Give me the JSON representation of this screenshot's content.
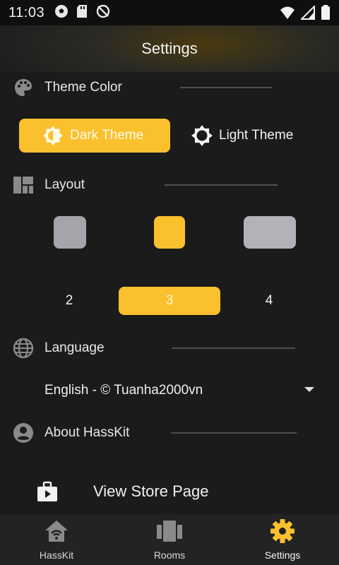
{
  "status_bar": {
    "time": "11:03"
  },
  "app_bar": {
    "title": "Settings"
  },
  "sections": {
    "theme": {
      "label": "Theme Color"
    },
    "layout": {
      "label": "Layout"
    },
    "language": {
      "label": "Language"
    },
    "about": {
      "label": "About HassKit"
    }
  },
  "theme_options": {
    "dark": {
      "label": "Dark Theme",
      "selected": true
    },
    "light": {
      "label": "Light Theme",
      "selected": false
    }
  },
  "layout_options": {
    "counts": [
      "2",
      "3",
      "4"
    ],
    "selected": "3"
  },
  "language_select": {
    "value": "English - © Tuanha2000vn"
  },
  "store_link": {
    "label": "View Store Page"
  },
  "bottom_nav": {
    "items": [
      {
        "label": "HassKit",
        "icon": "home-wifi-icon"
      },
      {
        "label": "Rooms",
        "icon": "rooms-icon"
      },
      {
        "label": "Settings",
        "icon": "gear-icon",
        "active": true
      }
    ]
  },
  "colors": {
    "accent": "#fbc02d",
    "background": "#1b1b1b",
    "nav_background": "#232323"
  }
}
